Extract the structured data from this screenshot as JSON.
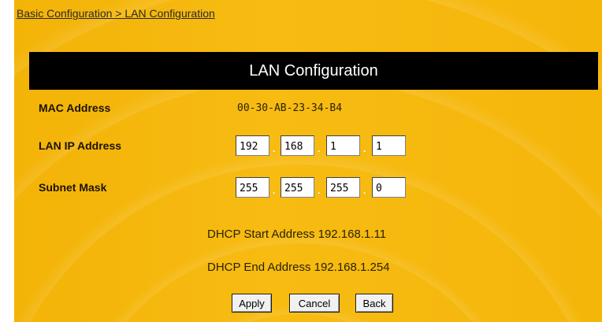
{
  "breadcrumb": {
    "parent": "Basic Configuration",
    "separator": ">",
    "current": "LAN Configuration"
  },
  "title": "LAN Configuration",
  "fields": {
    "mac": {
      "label": "MAC Address",
      "value": "00-30-AB-23-34-B4"
    },
    "lan_ip": {
      "label": "LAN IP Address",
      "octets": [
        "192",
        "168",
        "1",
        "1"
      ]
    },
    "subnet": {
      "label": "Subnet Mask",
      "octets": [
        "255",
        "255",
        "255",
        "0"
      ]
    }
  },
  "separator_dot": ".",
  "dhcp": {
    "start": "DHCP Start Address 192.168.1.11",
    "end": "DHCP End Address 192.168.1.254"
  },
  "buttons": {
    "apply": "Apply",
    "cancel": "Cancel",
    "back": "Back"
  },
  "colors": {
    "background": "#f5b60a",
    "title_bar": "#000000",
    "title_text": "#ffffff"
  }
}
